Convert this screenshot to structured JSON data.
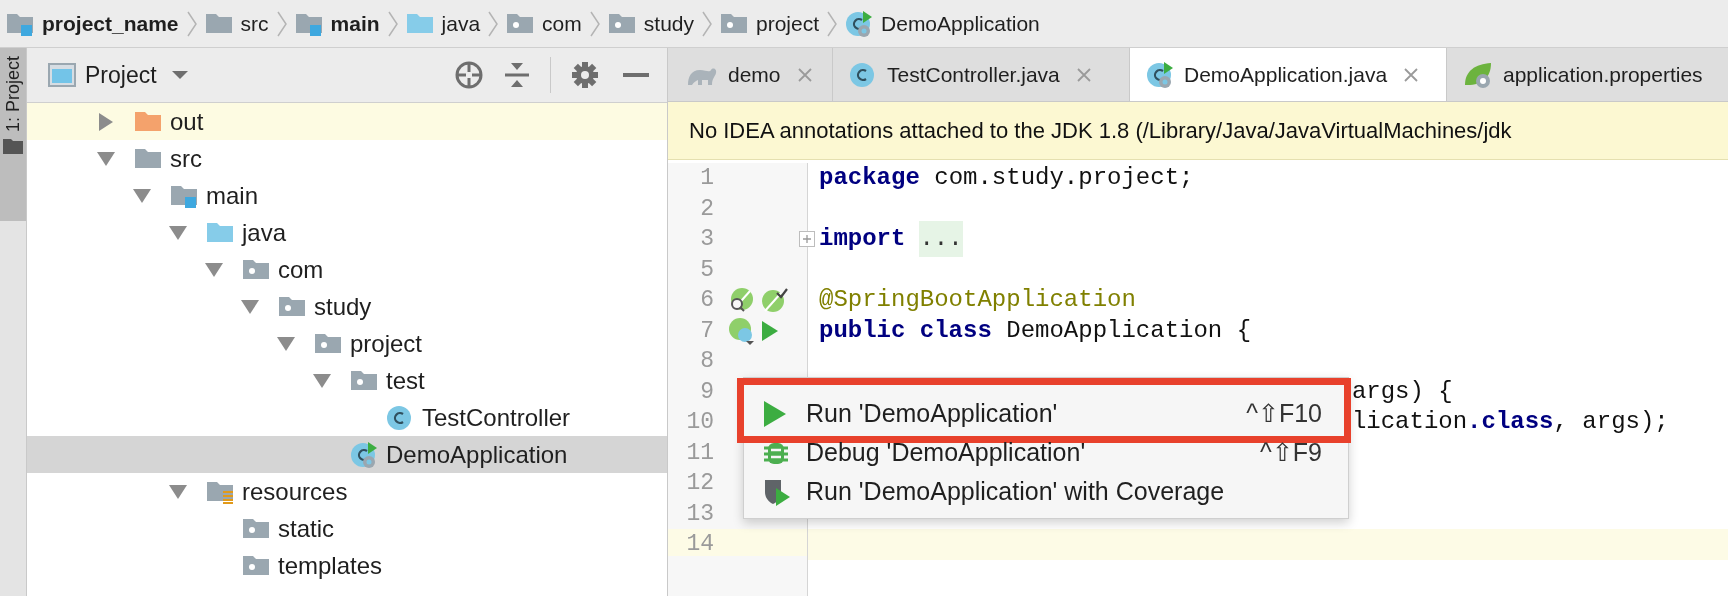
{
  "breadcrumbs": [
    {
      "label": "project_name",
      "kind": "module"
    },
    {
      "label": "src",
      "kind": "folder"
    },
    {
      "label": "main",
      "kind": "module"
    },
    {
      "label": "java",
      "kind": "source"
    },
    {
      "label": "com",
      "kind": "package"
    },
    {
      "label": "study",
      "kind": "package"
    },
    {
      "label": "project",
      "kind": "package"
    },
    {
      "label": "DemoApplication",
      "kind": "spring-class"
    }
  ],
  "side_strip": {
    "label": "1: Project",
    "selected": true
  },
  "project_panel": {
    "title": "Project",
    "tree": [
      {
        "label": "out",
        "kind": "excluded",
        "expanded": false,
        "selected": false
      },
      {
        "label": "src",
        "kind": "folder",
        "expanded": true,
        "selected": false,
        "children": [
          {
            "label": "main",
            "kind": "module",
            "expanded": true,
            "selected": false,
            "children": [
              {
                "label": "java",
                "kind": "source",
                "expanded": true,
                "selected": false,
                "children": [
                  {
                    "label": "com",
                    "kind": "package",
                    "expanded": true,
                    "selected": false,
                    "children": [
                      {
                        "label": "study",
                        "kind": "package",
                        "expanded": true,
                        "selected": false,
                        "children": [
                          {
                            "label": "project",
                            "kind": "package",
                            "expanded": true,
                            "selected": false,
                            "children": [
                              {
                                "label": "test",
                                "kind": "package",
                                "expanded": true,
                                "selected": false,
                                "children": [
                                  {
                                    "label": "TestController",
                                    "kind": "class",
                                    "selected": false
                                  }
                                ]
                              },
                              {
                                "label": "DemoApplication",
                                "kind": "spring-class",
                                "selected": true
                              }
                            ]
                          }
                        ]
                      }
                    ]
                  }
                ]
              },
              {
                "label": "resources",
                "kind": "resources",
                "expanded": true,
                "selected": false,
                "children": [
                  {
                    "label": "static",
                    "kind": "package",
                    "selected": false
                  },
                  {
                    "label": "templates",
                    "kind": "package",
                    "selected": false
                  }
                ]
              }
            ]
          }
        ]
      }
    ]
  },
  "tabs": [
    {
      "label": "demo",
      "kind": "gradle",
      "selected": false,
      "closable": true
    },
    {
      "label": "TestController.java",
      "kind": "class",
      "selected": false,
      "closable": true
    },
    {
      "label": "DemoApplication.java",
      "kind": "spring-class",
      "selected": true,
      "closable": true
    },
    {
      "label": "application.properties",
      "kind": "spring-properties",
      "selected": false,
      "closable": false
    }
  ],
  "banner": "No IDEA annotations attached to the JDK 1.8 (/Library/Java/JavaVirtualMachines/jdk",
  "editor": {
    "lines": [
      {
        "number": "1",
        "current": false,
        "tokens": [
          {
            "kind": "keyword",
            "text": "package"
          },
          {
            "kind": "plain",
            "text": " com.study.project;"
          }
        ]
      },
      {
        "number": "2",
        "current": false
      },
      {
        "number": "3",
        "current": false,
        "folded": true,
        "tokens": [
          {
            "kind": "keyword",
            "text": "import"
          },
          {
            "kind": "fold",
            "text": "..."
          }
        ]
      },
      {
        "number": "5",
        "current": false
      },
      {
        "number": "6",
        "current": false,
        "gutter": [
          {
            "kind": "spring-find"
          },
          {
            "kind": "spring-check"
          }
        ],
        "tokens": [
          {
            "kind": "annotation",
            "text": "@SpringBootApplication"
          }
        ]
      },
      {
        "number": "7",
        "current": false,
        "gutter": [
          {
            "kind": "spring-class"
          },
          {
            "kind": "run"
          }
        ],
        "tokens": [
          {
            "kind": "keyword",
            "text": "public class"
          },
          {
            "kind": "plain",
            "text": " DemoApplication {"
          }
        ]
      },
      {
        "number": "8",
        "current": false
      },
      {
        "number": "9",
        "current": false,
        "tokens": [
          {
            "kind": "plain",
            "text": "                                     args) {"
          }
        ]
      },
      {
        "number": "10",
        "current": false,
        "tokens": [
          {
            "kind": "plain",
            "text": "                                     lication"
          },
          {
            "kind": "keyword",
            "text": ".class"
          },
          {
            "kind": "plain",
            "text": ", args);"
          }
        ]
      },
      {
        "number": "11",
        "current": false
      },
      {
        "number": "12",
        "current": false
      },
      {
        "number": "13",
        "current": false
      },
      {
        "number": "14",
        "current": true
      }
    ]
  },
  "popup_menu": {
    "items": [
      {
        "kind": "run",
        "label": "Run 'DemoApplication'",
        "shortcut": "^⇧F10",
        "highlighted": true
      },
      {
        "kind": "debug",
        "label": "Debug 'DemoApplication'",
        "shortcut": "^⇧F9",
        "highlighted": false
      },
      {
        "kind": "coverage",
        "label": "Run 'DemoApplication' with Coverage",
        "highlighted": false
      }
    ]
  }
}
